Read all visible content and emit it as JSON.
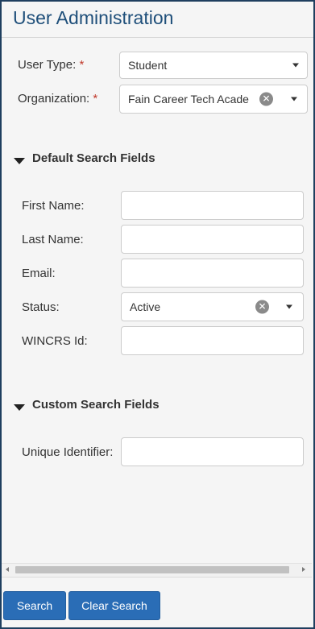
{
  "header": {
    "title": "User Administration"
  },
  "filters": {
    "user_type": {
      "label": "User Type:",
      "required_mark": "*",
      "value": "Student"
    },
    "organization": {
      "label": "Organization:",
      "required_mark": "*",
      "value": "Fain Career Tech Acade..."
    }
  },
  "default_section": {
    "title": "Default Search Fields",
    "first_name": {
      "label": "First Name:",
      "value": ""
    },
    "last_name": {
      "label": "Last Name:",
      "value": ""
    },
    "email": {
      "label": "Email:",
      "value": ""
    },
    "status": {
      "label": "Status:",
      "value": "Active"
    },
    "wincrs_id": {
      "label": "WINCRS Id:",
      "value": ""
    }
  },
  "custom_section": {
    "title": "Custom Search Fields",
    "unique_identifier": {
      "label": "Unique Identifier:",
      "value": ""
    }
  },
  "icons": {
    "clear": "clear-x-icon",
    "dropdown": "caret-down-icon",
    "section_toggle": "triangle-down-icon"
  },
  "footer": {
    "search_label": "Search",
    "clear_label": "Clear Search"
  },
  "colors": {
    "title": "#1f4f7a",
    "required": "#c0392b",
    "button": "#2a6db6",
    "frame_border": "#1f3f5f"
  }
}
